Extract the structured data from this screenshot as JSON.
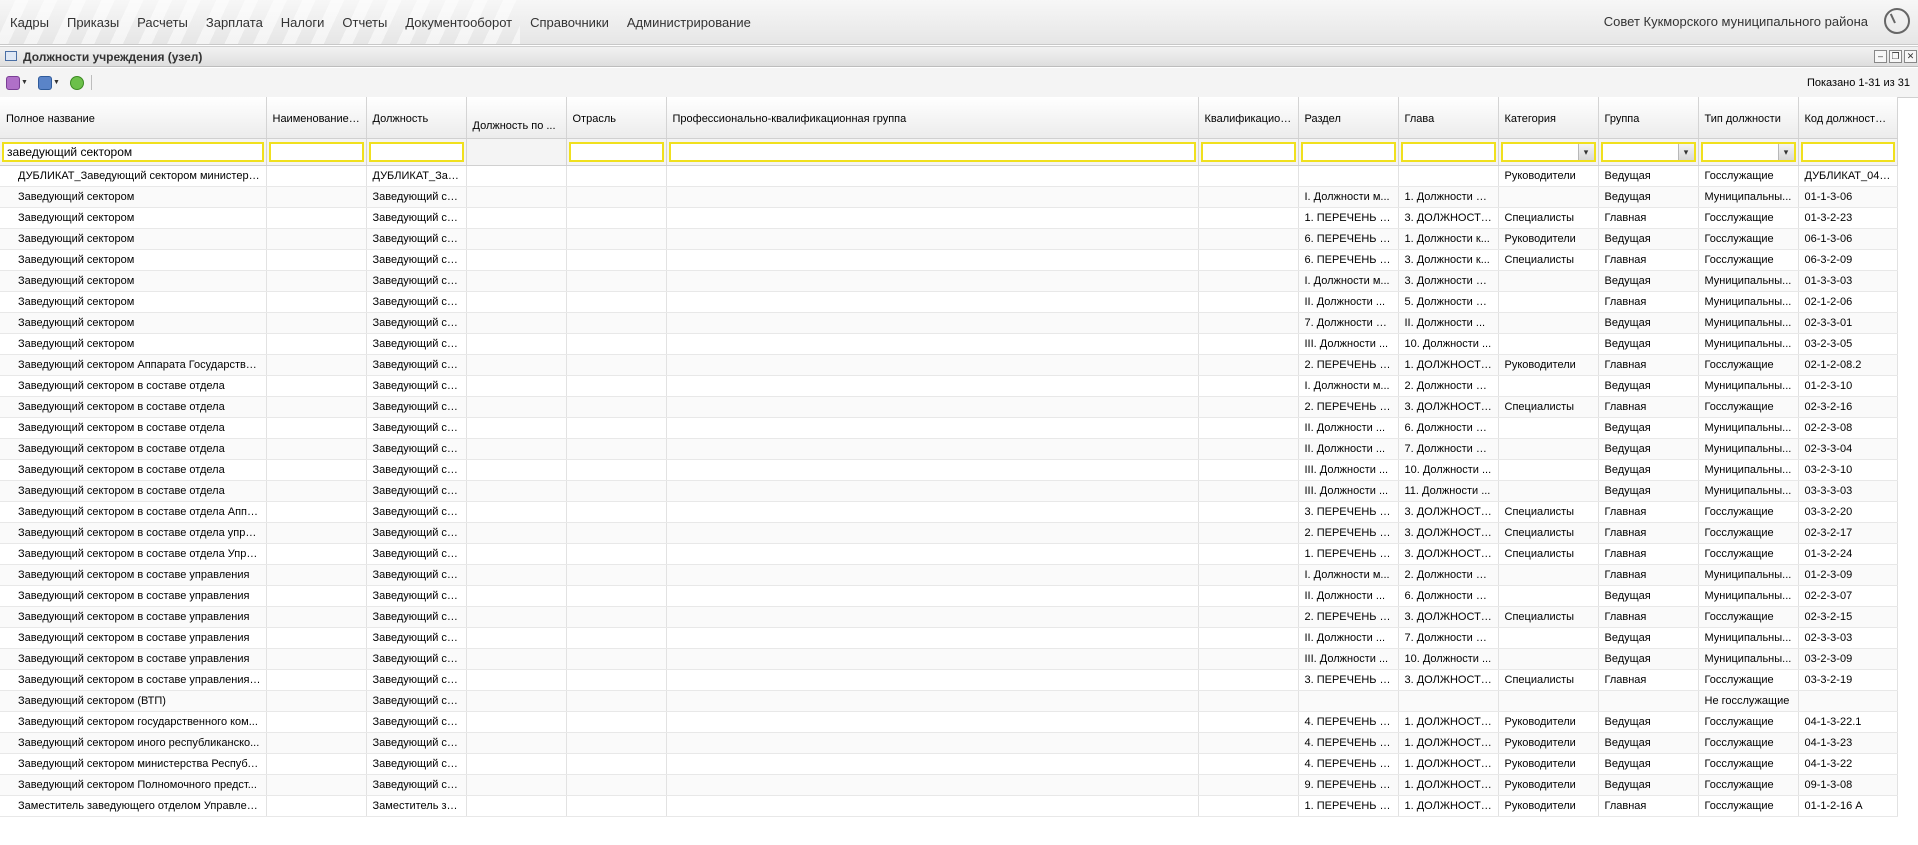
{
  "menu": {
    "items": [
      "Кадры",
      "Приказы",
      "Расчеты",
      "Зарплата",
      "Налоги",
      "Отчеты",
      "Документооборот",
      "Справочники",
      "Администрирование"
    ],
    "org_name": "Совет Кукморского муниципального района"
  },
  "window": {
    "title": "Должности учреждения (узел)",
    "shown": "Показано 1-31 из 31"
  },
  "grid": {
    "columns": [
      "Полное название",
      "Наименование ...",
      "Должность",
      "Должность по ...",
      "Отрасль",
      "Профессионально-квалификационная группа",
      "Квалификацион...",
      "Раздел",
      "Глава",
      "Категория",
      "Группа",
      "Тип должности",
      "Код должности ..."
    ],
    "filter_value": "заведующий сектором",
    "rows": [
      [
        "ДУБЛИКАТ_Заведующий сектором министерс...",
        "",
        "ДУБЛИКАТ_Зав...",
        "",
        "",
        "",
        "",
        "",
        "",
        "Руководители",
        "Ведущая",
        "Госслужащие",
        "ДУБЛИКАТ_04-..."
      ],
      [
        "Заведующий сектором",
        "",
        "Заведующий се...",
        "",
        "",
        "",
        "",
        "I. Должности м...",
        "1. Должности м...",
        "",
        "Ведущая",
        "Муниципальны...",
        "01-1-3-06"
      ],
      [
        "Заведующий сектором",
        "",
        "Заведующий се...",
        "",
        "",
        "",
        "",
        "1. ПЕРЕЧЕНЬ Д...",
        "3. ДОЛЖНОСТИ...",
        "Специалисты",
        "Главная",
        "Госслужащие",
        "01-3-2-23"
      ],
      [
        "Заведующий сектором",
        "",
        "Заведующий се...",
        "",
        "",
        "",
        "",
        "6. ПЕРЕЧЕНЬ Д...",
        "1. Должности к...",
        "Руководители",
        "Ведущая",
        "Госслужащие",
        "06-1-3-06"
      ],
      [
        "Заведующий сектором",
        "",
        "Заведующий се...",
        "",
        "",
        "",
        "",
        "6. ПЕРЕЧЕНЬ Д...",
        "3. Должности к...",
        "Специалисты",
        "Главная",
        "Госслужащие",
        "06-3-2-09"
      ],
      [
        "Заведующий сектором",
        "",
        "Заведующий се...",
        "",
        "",
        "",
        "",
        "I. Должности м...",
        "3. Должности м...",
        "",
        "Ведущая",
        "Муниципальны...",
        "01-3-3-03"
      ],
      [
        "Заведующий сектором",
        "",
        "Заведующий се...",
        "",
        "",
        "",
        "",
        "II. Должности ...",
        "5. Должности м...",
        "",
        "Главная",
        "Муниципальны...",
        "02-1-2-06"
      ],
      [
        "Заведующий сектором",
        "",
        "Заведующий се...",
        "",
        "",
        "",
        "",
        "7. Должности м...",
        "II. Должности ...",
        "",
        "Ведущая",
        "Муниципальны...",
        "02-3-3-01"
      ],
      [
        "Заведующий сектором",
        "",
        "Заведующий се...",
        "",
        "",
        "",
        "",
        "III. Должности ...",
        "10. Должности ...",
        "",
        "Ведущая",
        "Муниципальны...",
        "03-2-3-05"
      ],
      [
        "Заведующий сектором Аппарата Государстве...",
        "",
        "Заведующий се...",
        "",
        "",
        "",
        "",
        "2. ПЕРЕЧЕНЬ Д...",
        "1. ДОЛЖНОСТИ...",
        "Руководители",
        "Главная",
        "Госслужащие",
        "02-1-2-08.2"
      ],
      [
        "Заведующий сектором в составе отдела",
        "",
        "Заведующий се...",
        "",
        "",
        "",
        "",
        "I. Должности м...",
        "2. Должности м...",
        "",
        "Ведущая",
        "Муниципальны...",
        "01-2-3-10"
      ],
      [
        "Заведующий сектором в составе отдела",
        "",
        "Заведующий се...",
        "",
        "",
        "",
        "",
        "2. ПЕРЕЧЕНЬ Д...",
        "3. ДОЛЖНОСТИ...",
        "Специалисты",
        "Главная",
        "Госслужащие",
        "02-3-2-16"
      ],
      [
        "Заведующий сектором в составе отдела",
        "",
        "Заведующий се...",
        "",
        "",
        "",
        "",
        "II. Должности ...",
        "6. Должности м...",
        "",
        "Ведущая",
        "Муниципальны...",
        "02-2-3-08"
      ],
      [
        "Заведующий сектором в составе отдела",
        "",
        "Заведующий се...",
        "",
        "",
        "",
        "",
        "II. Должности ...",
        "7. Должности м...",
        "",
        "Ведущая",
        "Муниципальны...",
        "02-3-3-04"
      ],
      [
        "Заведующий сектором в составе отдела",
        "",
        "Заведующий се...",
        "",
        "",
        "",
        "",
        "III. Должности ...",
        "10. Должности ...",
        "",
        "Ведущая",
        "Муниципальны...",
        "03-2-3-10"
      ],
      [
        "Заведующий сектором в составе отдела",
        "",
        "Заведующий се...",
        "",
        "",
        "",
        "",
        "III. Должности ...",
        "11. Должности ...",
        "",
        "Ведущая",
        "Муниципальны...",
        "03-3-3-03"
      ],
      [
        "Заведующий сектором в составе отдела Аппа...",
        "",
        "Заведующий се...",
        "",
        "",
        "",
        "",
        "3. ПЕРЕЧЕНЬ Д...",
        "3. ДОЛЖНОСТИ...",
        "Специалисты",
        "Главная",
        "Госслужащие",
        "03-3-2-20"
      ],
      [
        "Заведующий сектором в составе отдела упра...",
        "",
        "Заведующий се...",
        "",
        "",
        "",
        "",
        "2. ПЕРЕЧЕНЬ Д...",
        "3. ДОЛЖНОСТИ...",
        "Специалисты",
        "Главная",
        "Госслужащие",
        "02-3-2-17"
      ],
      [
        "Заведующий сектором в составе отдела Упра...",
        "",
        "Заведующий се...",
        "",
        "",
        "",
        "",
        "1. ПЕРЕЧЕНЬ Д...",
        "3. ДОЛЖНОСТИ...",
        "Специалисты",
        "Главная",
        "Госслужащие",
        "01-3-2-24"
      ],
      [
        "Заведующий сектором в составе управления",
        "",
        "Заведующий се...",
        "",
        "",
        "",
        "",
        "I. Должности м...",
        "2. Должности м...",
        "",
        "Главная",
        "Муниципальны...",
        "01-2-3-09"
      ],
      [
        "Заведующий сектором в составе управления",
        "",
        "Заведующий се...",
        "",
        "",
        "",
        "",
        "II. Должности ...",
        "6. Должности м...",
        "",
        "Ведущая",
        "Муниципальны...",
        "02-2-3-07"
      ],
      [
        "Заведующий сектором в составе управления",
        "",
        "Заведующий се...",
        "",
        "",
        "",
        "",
        "2. ПЕРЕЧЕНЬ Д...",
        "3. ДОЛЖНОСТИ...",
        "Специалисты",
        "Главная",
        "Госслужащие",
        "02-3-2-15"
      ],
      [
        "Заведующий сектором в составе управления",
        "",
        "Заведующий се...",
        "",
        "",
        "",
        "",
        "II. Должности ...",
        "7. Должности м...",
        "",
        "Ведущая",
        "Муниципальны...",
        "02-3-3-03"
      ],
      [
        "Заведующий сектором в составе управления",
        "",
        "Заведующий се...",
        "",
        "",
        "",
        "",
        "III. Должности ...",
        "10. Должности ...",
        "",
        "Ведущая",
        "Муниципальны...",
        "03-2-3-09"
      ],
      [
        "Заведующий сектором в составе управления ...",
        "",
        "Заведующий се...",
        "",
        "",
        "",
        "",
        "3. ПЕРЕЧЕНЬ Д...",
        "3. ДОЛЖНОСТИ...",
        "Специалисты",
        "Главная",
        "Госслужащие",
        "03-3-2-19"
      ],
      [
        "Заведующий сектором (ВТП)",
        "",
        "Заведующий се...",
        "",
        "",
        "",
        "",
        "",
        "",
        "",
        "",
        "Не госслужащие",
        ""
      ],
      [
        "Заведующий сектором государственного ком...",
        "",
        "Заведующий се...",
        "",
        "",
        "",
        "",
        "4. ПЕРЕЧЕНЬ Д...",
        "1. ДОЛЖНОСТИ...",
        "Руководители",
        "Ведущая",
        "Госслужащие",
        "04-1-3-22.1"
      ],
      [
        "Заведующий сектором иного республиканско...",
        "",
        "Заведующий се...",
        "",
        "",
        "",
        "",
        "4. ПЕРЕЧЕНЬ Д...",
        "1. ДОЛЖНОСТИ...",
        "Руководители",
        "Ведущая",
        "Госслужащие",
        "04-1-3-23"
      ],
      [
        "Заведующий сектором министерства Республ...",
        "",
        "Заведующий се...",
        "",
        "",
        "",
        "",
        "4. ПЕРЕЧЕНЬ Д...",
        "1. ДОЛЖНОСТИ...",
        "Руководители",
        "Ведущая",
        "Госслужащие",
        "04-1-3-22"
      ],
      [
        "Заведующий сектором Полномочного предст...",
        "",
        "Заведующий се...",
        "",
        "",
        "",
        "",
        "9. ПЕРЕЧЕНЬ Д...",
        "1. ДОЛЖНОСТИ...",
        "Руководители",
        "Ведущая",
        "Госслужащие",
        "09-1-3-08"
      ],
      [
        "Заместитель заведующего отделом Управлен...",
        "",
        "Заместитель за...",
        "",
        "",
        "",
        "",
        "1. ПЕРЕЧЕНЬ Д...",
        "1. ДОЛЖНОСТИ...",
        "Руководители",
        "Главная",
        "Госслужащие",
        "01-1-2-16 А"
      ]
    ]
  },
  "icons": [
    "add-icon",
    "print-icon",
    "refresh-icon",
    "clock-icon",
    "window-icon",
    "minimize-icon",
    "restore-icon",
    "close-icon",
    "dropdown-icon"
  ]
}
